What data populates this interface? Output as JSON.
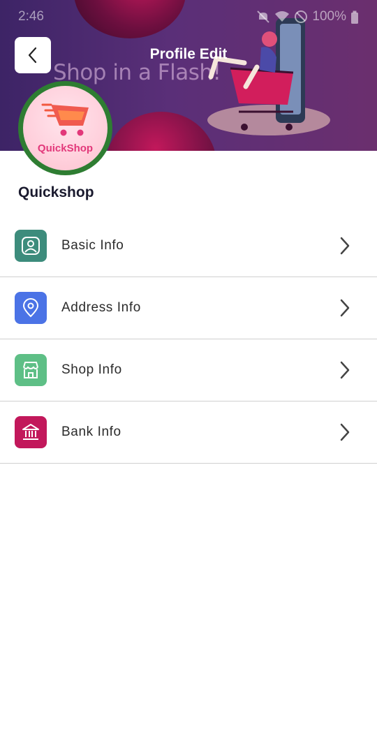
{
  "status_bar": {
    "time": "2:46",
    "battery": "100%"
  },
  "header": {
    "title": "Profile Edit",
    "banner_tagline": "Shop in a Flash!",
    "back_icon": "chevron-left-icon",
    "colors": {
      "banner": "#4a2a6e",
      "accent": "#c2185b"
    }
  },
  "profile": {
    "logo_text": "QuickShop",
    "shop_name": "Quickshop",
    "avatar_ring_color": "#2e7d32"
  },
  "menu": [
    {
      "label": "Basic Info",
      "icon": "user-badge-icon",
      "color": "#3d8c7c"
    },
    {
      "label": "Address Info",
      "icon": "location-pin-icon",
      "color": "#4b73e6"
    },
    {
      "label": "Shop Info",
      "icon": "storefront-icon",
      "color": "#5ebf86"
    },
    {
      "label": "Bank Info",
      "icon": "bank-icon",
      "color": "#c2185b"
    }
  ]
}
